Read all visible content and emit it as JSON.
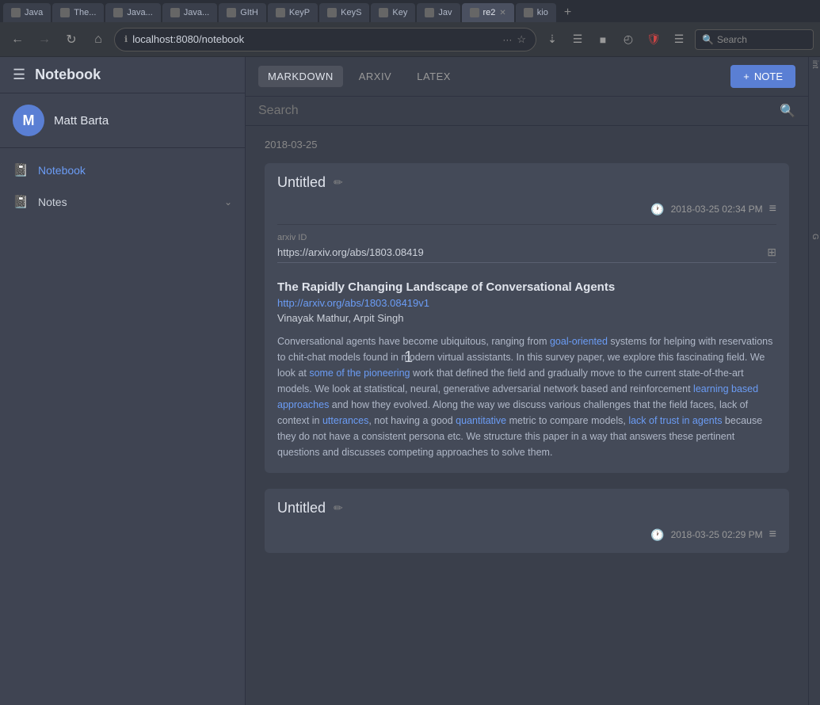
{
  "browser": {
    "tabs": [
      {
        "label": "Java",
        "favicon": "J",
        "active": false
      },
      {
        "label": "The...",
        "favicon": "T",
        "active": false
      },
      {
        "label": "Java...",
        "favicon": "J",
        "active": false
      },
      {
        "label": "Java...",
        "favicon": "J",
        "active": false
      },
      {
        "label": "GItH",
        "favicon": "G",
        "active": false
      },
      {
        "label": "KeyP",
        "favicon": "K",
        "active": false
      },
      {
        "label": "KeyS",
        "favicon": "K",
        "active": false
      },
      {
        "label": "Key",
        "favicon": "K",
        "active": false
      },
      {
        "label": "Jav",
        "favicon": "J",
        "active": false
      },
      {
        "label": "re2",
        "favicon": "r",
        "active": true
      },
      {
        "label": "kio",
        "favicon": "k",
        "active": false
      }
    ],
    "address": "localhost:8080/notebook",
    "search_placeholder": "Search"
  },
  "sidebar": {
    "app_title": "Notebook",
    "hamburger_label": "☰",
    "user": {
      "initial": "M",
      "name": "Matt Barta"
    },
    "nav_items": [
      {
        "label": "Notebook",
        "icon": "📓",
        "active": true
      },
      {
        "label": "Notes",
        "icon": "📓",
        "active": false,
        "has_chevron": true
      }
    ]
  },
  "main": {
    "search_placeholder": "Search",
    "tabs": [
      {
        "label": "MARKDOWN",
        "active": true
      },
      {
        "label": "ARXIV",
        "active": false
      },
      {
        "label": "LATEX",
        "active": false
      }
    ],
    "add_note_label": "+ NOTE",
    "date_header": "2018-03-25",
    "notes": [
      {
        "id": "note1",
        "title": "Untitled",
        "timestamp": "2018-03-25 02:34 PM",
        "arxiv_label": "arxiv ID",
        "arxiv_url": "https://arxiv.org/abs/1803.08419",
        "paper_title": "The Rapidly Changing Landscape of Conversational Agents",
        "paper_link": "http://arxiv.org/abs/1803.08419v1",
        "paper_authors": "Vinayak Mathur, Arpit Singh",
        "paper_abstract": "Conversational agents have become ubiquitous, ranging from goal-oriented systems for helping with reservations to chit-chat models found in modern virtual assistants. In this survey paper, we explore this fascinating field. We look at some of the pioneering work that defined the field and gradually move to the current state-of-the-art models. We look at statistical, neural, generative adversarial network based and reinforcement learning based approaches and how they evolved. Along the way we discuss various challenges that the field faces, lack of context in utterances, not having a good quantitative metric to compare models, lack of trust in agents because they do not have a consistent persona etc. We structure this paper in a way that answers these pertinent questions and discusses competing approaches to solve them."
      },
      {
        "id": "note2",
        "title": "Untitled",
        "timestamp": "2018-03-25 02:29 PM"
      }
    ]
  },
  "right_panel": {
    "text1": "int",
    "text2": "G"
  }
}
